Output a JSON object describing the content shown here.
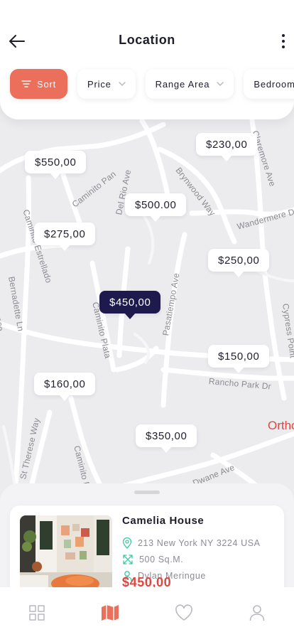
{
  "header": {
    "title": "Location",
    "back_icon": "arrow-left-icon",
    "more_icon": "more-vertical-icon"
  },
  "filters": [
    {
      "label": "Sort",
      "icon": "sort-lines-icon",
      "active": true
    },
    {
      "label": "Price",
      "icon": "chevron-down-icon"
    },
    {
      "label": "Range Area",
      "icon": "chevron-down-icon"
    },
    {
      "label": "Bedroom",
      "icon": "chevron-down-icon"
    }
  ],
  "map": {
    "streets": [
      "Caminito Pan",
      "Del Rio Ave",
      "Brynwood Way",
      "Claremore Ave",
      "Wandermere Dr",
      "Caminito Estrellado",
      "Bernadette Ln",
      "Terrace",
      "Caminito Plata",
      "Pasatiempo Ave",
      "Rancho Park Dr",
      "Cypress Point",
      "St Therese Way",
      "Caminito De",
      "Dwane Ave"
    ],
    "city_label": "Ortho",
    "price_pins": [
      {
        "label": "$550,00"
      },
      {
        "label": "$230,00"
      },
      {
        "label": "$500.00"
      },
      {
        "label": "$275,00"
      },
      {
        "label": "$250,00"
      },
      {
        "label": "$450,00",
        "selected": true
      },
      {
        "label": "$150,00"
      },
      {
        "label": "$160,00"
      },
      {
        "label": "$350,00"
      }
    ]
  },
  "listing": {
    "name": "Camelia House",
    "address": "213 New York NY 3224 USA",
    "area": "500 Sq.M.",
    "agent": "Dylan Meringue",
    "price": "$450,00"
  },
  "tabbar": [
    {
      "icon": "grid-icon",
      "active": false
    },
    {
      "icon": "map-icon",
      "active": true
    },
    {
      "icon": "heart-icon",
      "active": false
    },
    {
      "icon": "user-icon",
      "active": false
    }
  ],
  "colors": {
    "accent": "#ec6f5b",
    "selected_pin": "#1e1a4d",
    "price": "#e0453f",
    "map_bg": "#ececef"
  }
}
